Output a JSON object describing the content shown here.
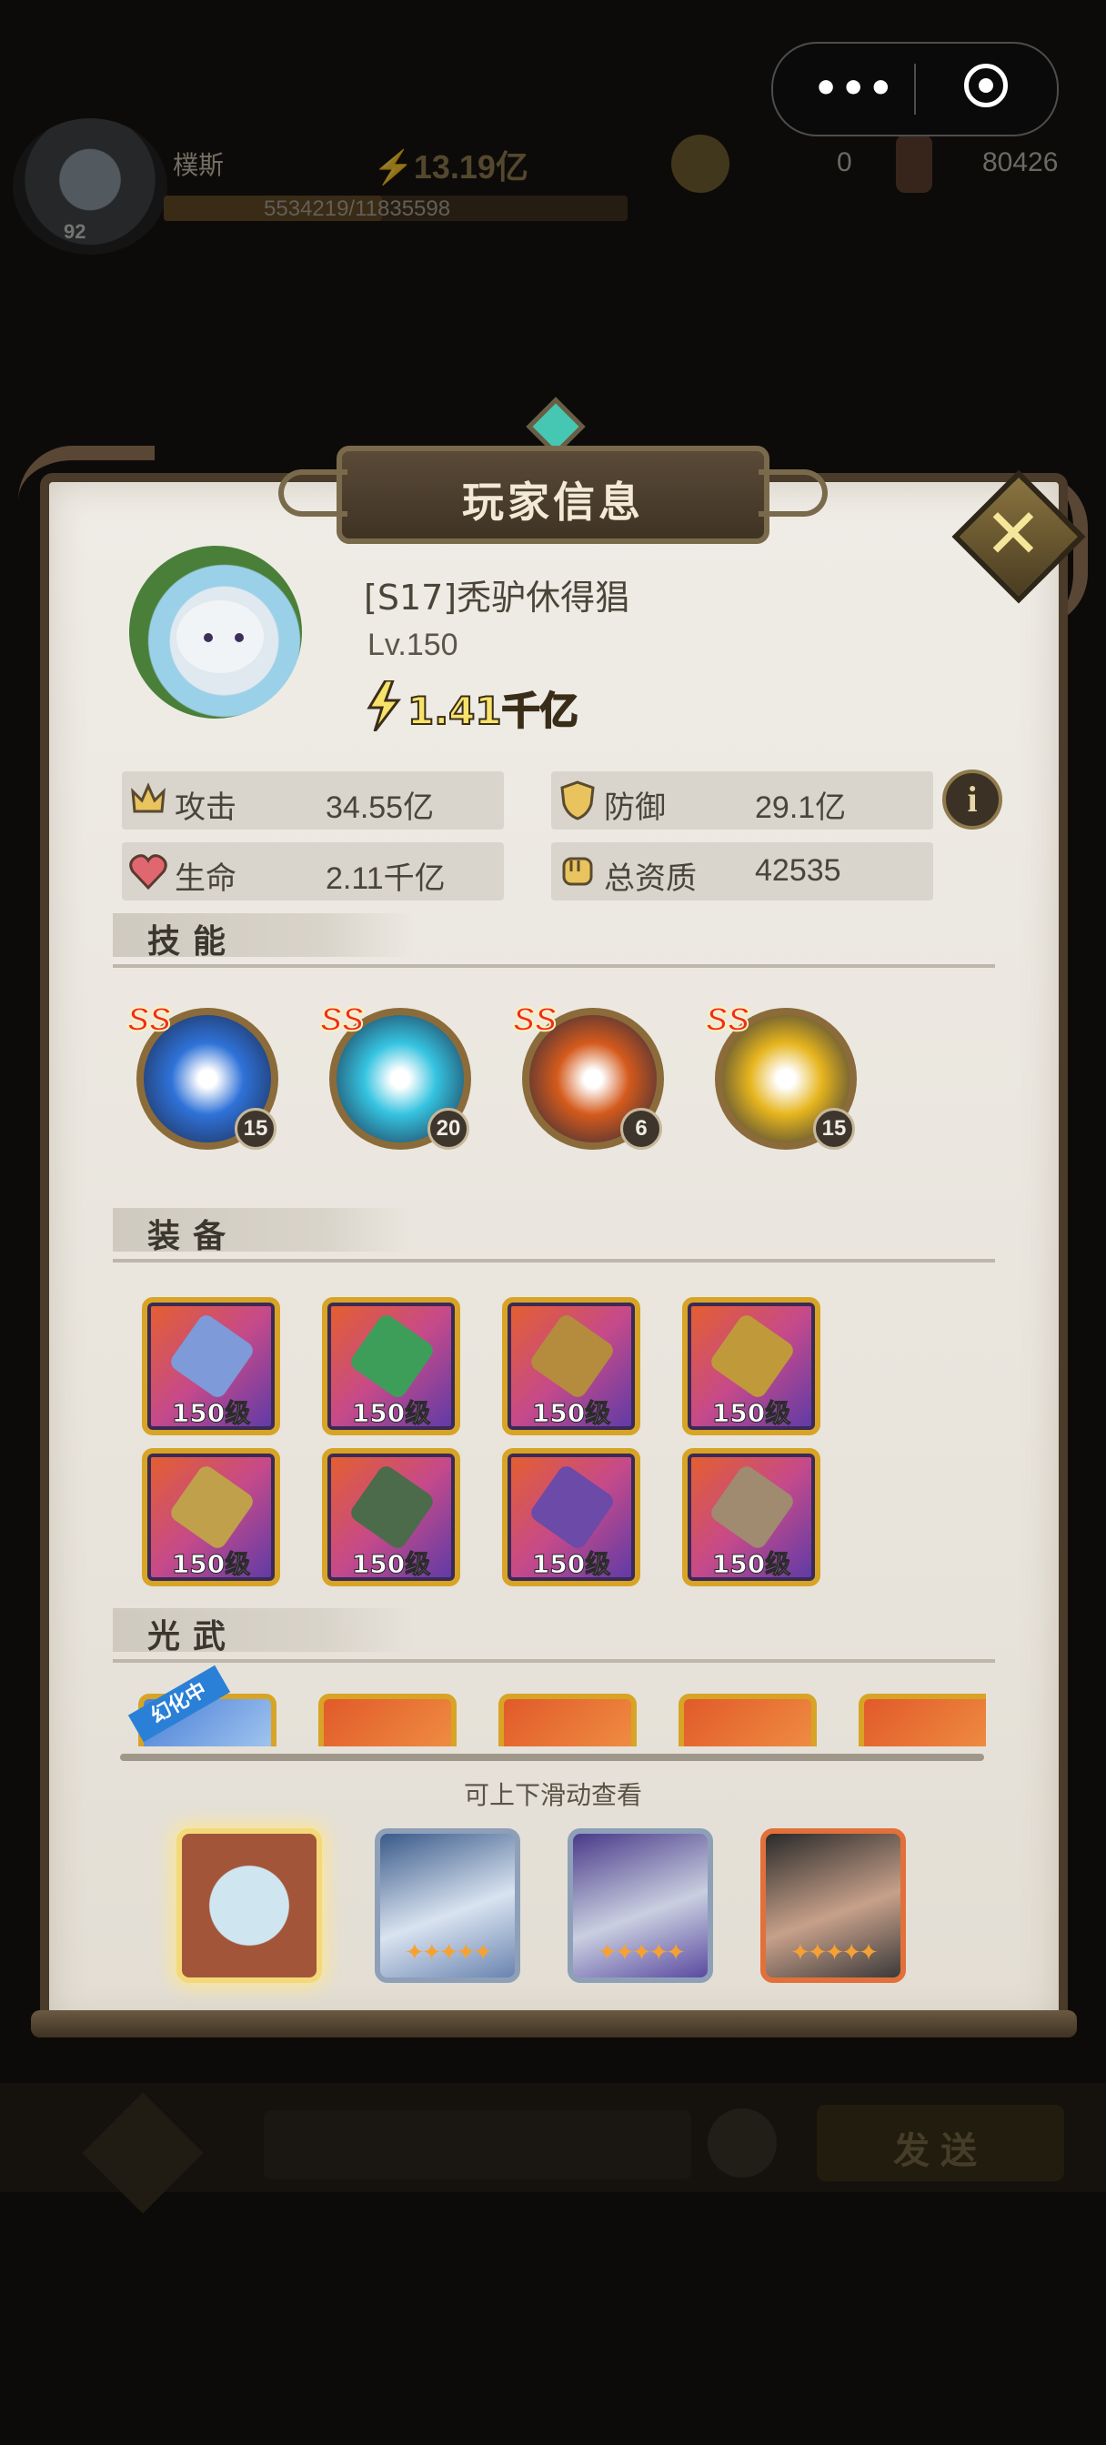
{
  "hud": {
    "name_partial": "樸斯",
    "power": "13.19亿",
    "exp": "5534219/11835598",
    "avatar_level": "92",
    "currency1": "0",
    "currency2": "80426"
  },
  "capsule": {
    "menu_icon": "more-dots-icon",
    "close_icon": "target-icon"
  },
  "panel": {
    "title": "玩家信息",
    "player": {
      "name": "[S17]秃驴休得猖",
      "level": "Lv.150",
      "power": "1.41千亿"
    },
    "stats": [
      {
        "label": "攻击",
        "value": "34.55亿",
        "icon": "attack-crown-icon"
      },
      {
        "label": "防御",
        "value": "29.1亿",
        "icon": "shield-icon"
      },
      {
        "label": "生命",
        "value": "2.11千亿",
        "icon": "heart-icon"
      },
      {
        "label": "总资质",
        "value": "42535",
        "icon": "fist-icon"
      }
    ],
    "info_label": "i",
    "sections": {
      "skills": "技能",
      "equipment": "装备",
      "light_weapons": "光武"
    },
    "skills": [
      {
        "rank": "SS",
        "level": "15",
        "color": "#2f72d8"
      },
      {
        "rank": "SS",
        "level": "20",
        "color": "#35c3e0"
      },
      {
        "rank": "SS",
        "level": "6",
        "color": "#d45a1c"
      },
      {
        "rank": "SS",
        "level": "15",
        "color": "#e6b51e"
      }
    ],
    "equipment": [
      {
        "level": "150级",
        "color": "#7e9ad8"
      },
      {
        "level": "150级",
        "color": "#3d9e5a"
      },
      {
        "level": "150级",
        "color": "#b58c3d"
      },
      {
        "level": "150级",
        "color": "#c09a3a"
      },
      {
        "level": "150级",
        "color": "#c0a04a"
      },
      {
        "level": "150级",
        "color": "#4c6b4a"
      },
      {
        "level": "150级",
        "color": "#6b4aa8"
      },
      {
        "level": "150级",
        "color": "#a08a70"
      }
    ],
    "light_weapon_tag": "幻化中",
    "scroll_hint": "可上下滑动查看"
  },
  "heroes": [
    {
      "name": "hero-dragon-pet",
      "stars": "",
      "selected": true
    },
    {
      "name": "hero-silver-elf",
      "stars": "✦✦✦✦✦",
      "selected": false
    },
    {
      "name": "hero-mecha",
      "stars": "✦✦✦✦✦",
      "selected": false
    },
    {
      "name": "hero-dark-girl",
      "stars": "✦✦✦✦✦",
      "selected": false
    }
  ],
  "chat": {
    "send_label": "发送"
  },
  "colors": {
    "gold": "#f8e36a",
    "panel_bg": "#ece8e1",
    "frame": "#4a3b2a"
  }
}
